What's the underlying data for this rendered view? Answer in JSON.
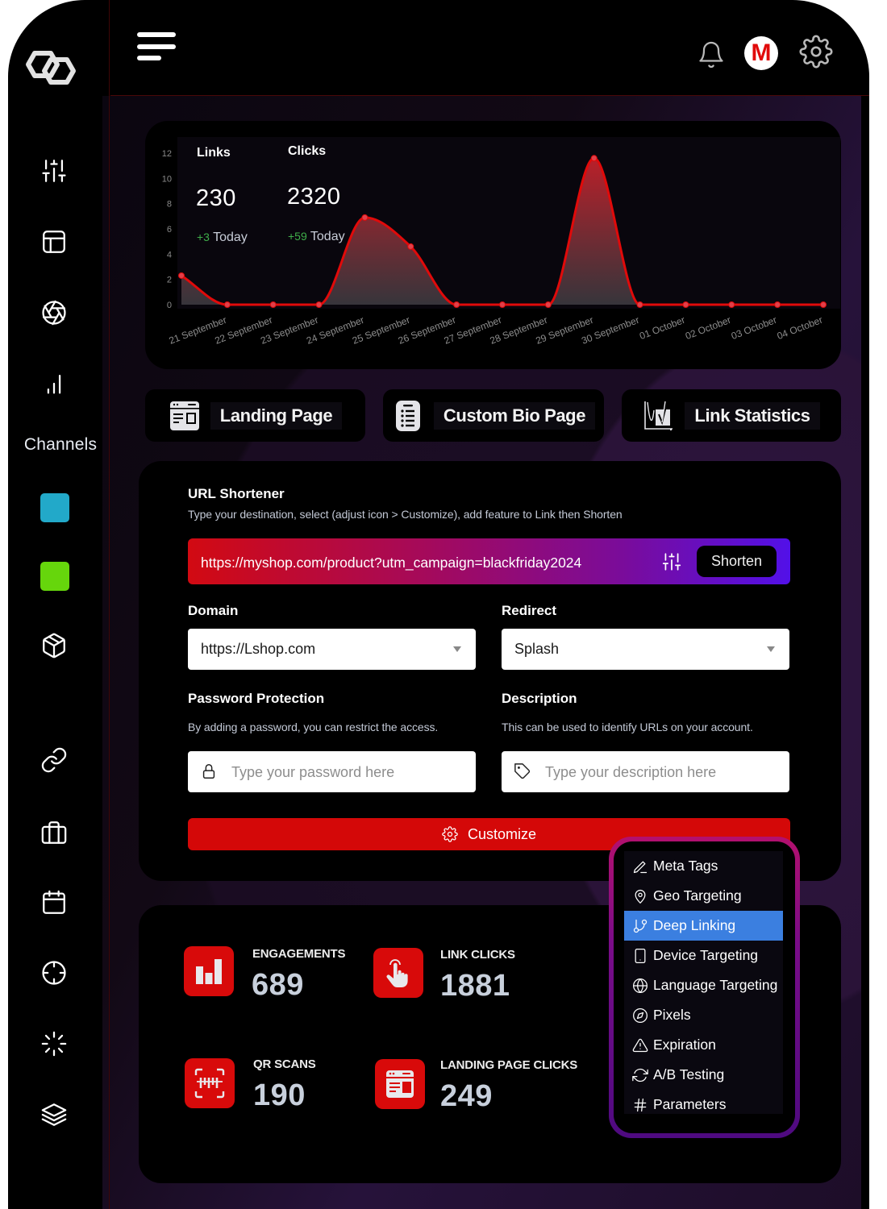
{
  "app": {
    "logo_icon": "hexagon-logo-icon"
  },
  "header": {
    "menu_icon": "hamburger-menu-icon",
    "notifications_icon": "bell-icon",
    "avatar_initial": "M",
    "settings_icon": "gear-icon"
  },
  "sidebar": {
    "nav_top": [
      "sliders-icon",
      "layout-icon",
      "aperture-icon",
      "bar-chart-icon"
    ],
    "section_label": "Channels",
    "channels": [
      {
        "color": "#22a9c9"
      },
      {
        "color": "#66d60c"
      }
    ],
    "nav_bottom": [
      "box-icon",
      "link-icon",
      "briefcase-icon",
      "calendar-icon",
      "crosshair-icon",
      "loader-icon",
      "layers-icon"
    ]
  },
  "summary": {
    "links": {
      "label": "Links",
      "value": "230",
      "delta": "+3",
      "delta_label": "Today"
    },
    "clicks": {
      "label": "Clicks",
      "value": "2320",
      "delta": "+59",
      "delta_label": "Today"
    }
  },
  "chart_data": {
    "type": "area",
    "title": "",
    "xlabel": "",
    "ylabel": "",
    "categories": [
      "",
      "21 September",
      "22 September",
      "23 September",
      "24 September",
      "25 September",
      "26 September",
      "27 September",
      "28 September",
      "29 September",
      "30 September",
      "01 October",
      "02 October",
      "03 October",
      "04 October"
    ],
    "values": [
      2.3,
      0,
      0,
      0,
      6.9,
      4.6,
      0,
      0,
      0,
      11.6,
      0,
      0,
      0,
      0,
      0
    ],
    "y_ticks": [
      "0",
      "2",
      "4",
      "6",
      "8",
      "10",
      "12"
    ],
    "ylim": [
      0,
      12
    ],
    "grid": false,
    "legend": "none",
    "colors": {
      "line": "#e00a0a",
      "fill_top": "#c8202a",
      "fill_bottom": "#3c3a40",
      "point": "#e0404a"
    }
  },
  "tabs": [
    {
      "label": "Landing Page",
      "icon": "landing-page-icon"
    },
    {
      "label": "Custom Bio Page",
      "icon": "bio-page-icon"
    },
    {
      "label": "Link Statistics",
      "icon": "link-statistics-icon"
    }
  ],
  "url_shortener": {
    "title": "URL Shortener",
    "subtitle": "Type your destination, select (adjust icon > Customize), add feature to Link then Shorten",
    "url_value": "https://myshop.com/product?utm_campaign=blackfriday2024",
    "adjust_icon": "sliders-icon",
    "shorten_label": "Shorten",
    "domain": {
      "label": "Domain",
      "value": "https://Lshop.com"
    },
    "redirect": {
      "label": "Redirect",
      "value": "Splash"
    },
    "password": {
      "label": "Password Protection",
      "help": "By adding a password, you can restrict the access.",
      "placeholder": "Type your password here",
      "icon": "lock-icon"
    },
    "description": {
      "label": "Description",
      "help": "This can be used to identify URLs on your account.",
      "placeholder": "Type your description here",
      "icon": "tag-icon"
    },
    "customize_label": "Customize"
  },
  "customize_menu": {
    "selected": "Deep Linking",
    "items": [
      {
        "label": "Meta Tags",
        "icon": "pencil-icon"
      },
      {
        "label": "Geo Targeting",
        "icon": "map-pin-icon"
      },
      {
        "label": "Deep Linking",
        "icon": "git-branch-icon"
      },
      {
        "label": "Device Targeting",
        "icon": "tablet-icon"
      },
      {
        "label": "Language Targeting",
        "icon": "globe-icon"
      },
      {
        "label": "Pixels",
        "icon": "compass-icon"
      },
      {
        "label": "Expiration",
        "icon": "alert-triangle-icon"
      },
      {
        "label": "A/B Testing",
        "icon": "refresh-icon"
      },
      {
        "label": "Parameters",
        "icon": "hash-icon"
      }
    ]
  },
  "stats": [
    {
      "label": "ENGAGEMENTS",
      "value": "689",
      "icon": "bar-chart-icon"
    },
    {
      "label": "LINK CLICKS",
      "value": "1881",
      "icon": "hand-pointer-icon"
    },
    {
      "label": "QR SCANS",
      "value": "190",
      "icon": "qr-scan-icon"
    },
    {
      "label": "LANDING PAGE CLICKS",
      "value": "249",
      "icon": "browser-window-icon"
    }
  ],
  "colors": {
    "accent_red": "#d40808",
    "menu_highlight": "#3b7fe0",
    "url_gradient_start": "#d20a12",
    "url_gradient_end": "#5210e8",
    "delta_green": "#3fae4a"
  }
}
